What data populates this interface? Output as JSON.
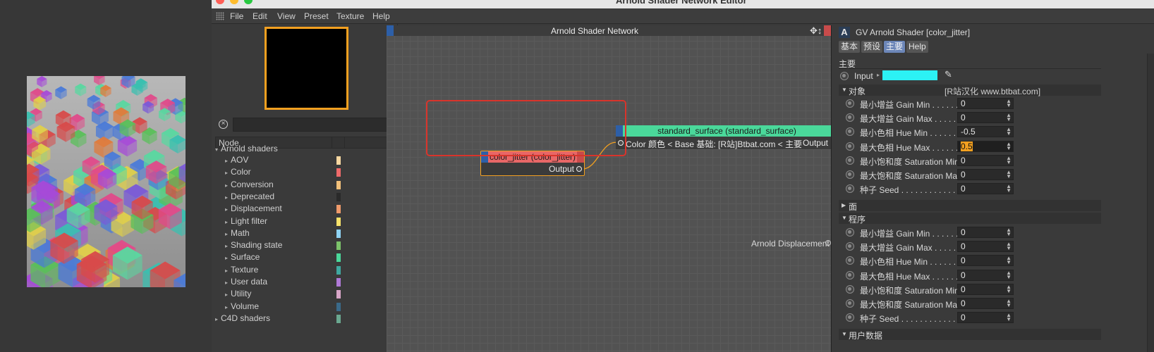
{
  "window": {
    "title": "Arnold Shader Network Editor"
  },
  "menu": [
    "File",
    "Edit",
    "View",
    "Preset",
    "Texture",
    "Help"
  ],
  "search": {
    "value": ""
  },
  "tree": {
    "header_node": "Node",
    "root": "Arnold shaders",
    "categories": [
      {
        "label": "AOV",
        "color": "#f6d7a0"
      },
      {
        "label": "Color",
        "color": "#ef6a6a"
      },
      {
        "label": "Conversion",
        "color": "#f2c07a"
      },
      {
        "label": "Deprecated",
        "color": "#2a2a2a"
      },
      {
        "label": "Displacement",
        "color": "#f09a6a"
      },
      {
        "label": "Light filter",
        "color": "#f7e26a"
      },
      {
        "label": "Math",
        "color": "#8fd3f4"
      },
      {
        "label": "Shading state",
        "color": "#7cc36a"
      },
      {
        "label": "Surface",
        "color": "#4ad89a"
      },
      {
        "label": "Texture",
        "color": "#3fa8a0"
      },
      {
        "label": "User data",
        "color": "#b07ad8"
      },
      {
        "label": "Utility",
        "color": "#d8a6c8"
      },
      {
        "label": "Volume",
        "color": "#3a6a8a"
      }
    ],
    "footer": "C4D shaders",
    "footer_color": "#6aa890"
  },
  "graph": {
    "title": "Arnold Shader Network",
    "node_color_jitter": {
      "title": "color_jitter (color_jitter)",
      "output": "Output"
    },
    "node_standard_surface": {
      "title": "standard_surface (standard_surface)",
      "input": "Color 颜色 < Base 基础: [R站]Btbat.com < 主要",
      "output": "Output"
    },
    "displacement_label": "Arnold Displacement"
  },
  "attributes": {
    "title": "GV Arnold Shader [color_jitter]",
    "tabs": [
      "基本",
      "预设",
      "主要",
      "Help"
    ],
    "active_tab": "主要",
    "section": "主要",
    "input_label": "Input",
    "input_color": "#2cf2f4",
    "group_object": {
      "label": "对象",
      "credit": "[R站汉化 www.btbat.com]"
    },
    "object_params": [
      {
        "label": "最小增益 Gain Min . . . . . . . .",
        "value": "0"
      },
      {
        "label": "最大增益 Gain Max . . . . . . . .",
        "value": "0"
      },
      {
        "label": "最小色相 Hue Min . . . . . . . .",
        "value": "-0.5"
      },
      {
        "label": "最大色相 Hue Max . . . . . . . .",
        "value": "0.5"
      },
      {
        "label": "最小饱和度 Saturation Min",
        "value": "0"
      },
      {
        "label": "最大饱和度 Saturation Max",
        "value": "0"
      },
      {
        "label": "种子 Seed . . . . . . . . . . . . . . .",
        "value": "0"
      }
    ],
    "group_face": {
      "label": "面"
    },
    "group_procedural": {
      "label": "程序"
    },
    "procedural_params": [
      {
        "label": "最小增益 Gain Min . . . . . . . .",
        "value": "0"
      },
      {
        "label": "最大增益 Gain Max . . . . . . . .",
        "value": "0"
      },
      {
        "label": "最小色相 Hue Min . . . . . . . .",
        "value": "0"
      },
      {
        "label": "最大色相 Hue Max . . . . . . . .",
        "value": "0"
      },
      {
        "label": "最小饱和度 Saturation Min",
        "value": "0"
      },
      {
        "label": "最大饱和度 Saturation Max",
        "value": "0"
      },
      {
        "label": "种子 Seed . . . . . . . . . . . . . . .",
        "value": "0"
      }
    ],
    "group_userdata": {
      "label": "用户数据"
    }
  }
}
